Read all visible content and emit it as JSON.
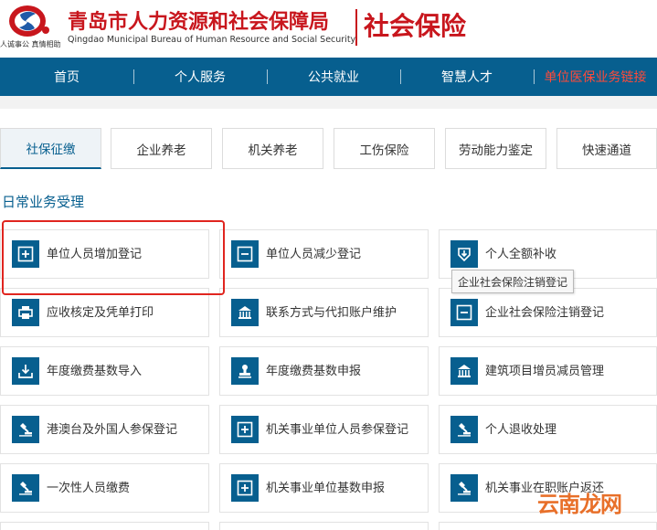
{
  "header": {
    "site_title": "青岛市人力资源和社会保障局",
    "site_subtitle": "Qingdao Municipal Bureau of Human Resource and Social Security",
    "section_title": "社会保险",
    "logo_slogan": "人诚事公 真情相助"
  },
  "nav": {
    "items": [
      {
        "label": "首页"
      },
      {
        "label": "个人服务"
      },
      {
        "label": "公共就业"
      },
      {
        "label": "智慧人才"
      },
      {
        "label": "单位医保业务链接"
      }
    ],
    "highlight_color": "#ff4a3a"
  },
  "tabs": [
    {
      "label": "社保征缴",
      "active": true
    },
    {
      "label": "企业养老",
      "active": false
    },
    {
      "label": "机关养老",
      "active": false
    },
    {
      "label": "工伤保险",
      "active": false
    },
    {
      "label": "劳动能力鉴定",
      "active": false
    },
    {
      "label": "快速通道",
      "active": false
    }
  ],
  "section": {
    "title": "日常业务受理"
  },
  "cards": [
    {
      "label": "单位人员增加登记",
      "icon": "add-box-icon"
    },
    {
      "label": "单位人员减少登记",
      "icon": "minus-box-icon"
    },
    {
      "label": "个人全额补收",
      "icon": "download-shield-icon"
    },
    {
      "label": "应收核定及凭单打印",
      "icon": "printer-icon"
    },
    {
      "label": "联系方式与代扣账户维护",
      "icon": "bank-icon"
    },
    {
      "label": "企业社会保险注销登记",
      "icon": "minus-box-icon"
    },
    {
      "label": "年度缴费基数导入",
      "icon": "import-icon"
    },
    {
      "label": "年度缴费基数申报",
      "icon": "stamp-icon"
    },
    {
      "label": "建筑项目增员减员管理",
      "icon": "bank-icon"
    },
    {
      "label": "港澳台及外国人参保登记",
      "icon": "stamp-icon"
    },
    {
      "label": "机关事业单位人员参保登记",
      "icon": "add-box-icon"
    },
    {
      "label": "个人退收处理",
      "icon": "stamp-icon"
    },
    {
      "label": "一次性人员缴费",
      "icon": "stamp-icon"
    },
    {
      "label": "机关事业单位基数申报",
      "icon": "add-box-icon"
    },
    {
      "label": "机关事业在职账户返还",
      "icon": "stamp-icon"
    }
  ],
  "tooltip": {
    "text": "企业社会保险注销登记"
  },
  "watermark": {
    "text": "云南龙网"
  },
  "colors": {
    "brand_red": "#c8161d",
    "nav_blue": "#075f8f",
    "highlight_red": "#e0251f"
  }
}
